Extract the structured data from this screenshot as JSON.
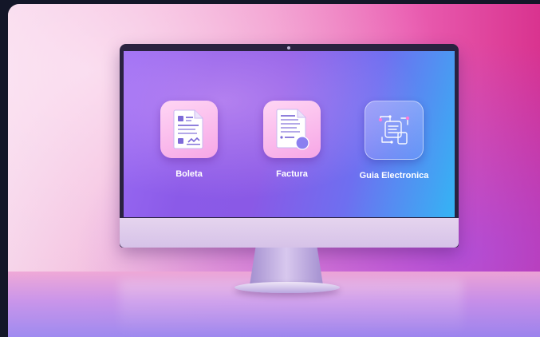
{
  "apps": [
    {
      "label": "Boleta",
      "icon": "receipt-document-icon"
    },
    {
      "label": "Factura",
      "icon": "invoice-document-icon"
    },
    {
      "label": "Guia Electronica",
      "icon": "electronic-guide-icon"
    }
  ],
  "colors": {
    "background_left": "#f6d5ea",
    "background_right": "#d9338f",
    "screen_left": "#9a6cf4",
    "screen_right": "#34b4f4",
    "tile_pink": "#f6a6e6",
    "label": "#ffffff"
  }
}
